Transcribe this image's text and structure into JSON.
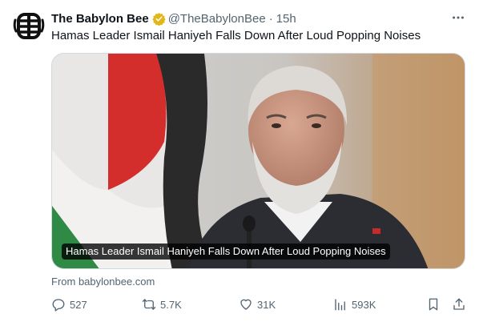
{
  "tweet": {
    "author_name": "The Babylon Bee",
    "handle": "@TheBabylonBee",
    "separator": "·",
    "time": "15h",
    "text": "Hamas Leader Ismail Haniyeh Falls Down After Loud Popping Noises"
  },
  "card": {
    "caption": "Hamas Leader Ismail Haniyeh Falls Down After Loud Popping Noises",
    "source": "From babylonbee.com"
  },
  "actions": {
    "replies": "527",
    "reposts": "5.7K",
    "likes": "31K",
    "views": "593K"
  },
  "icons": {
    "avatar": "babylon-bee-logo",
    "verified": "gold-verified-badge",
    "more": "more-horizontal-icon",
    "reply": "reply-icon",
    "repost": "repost-icon",
    "like": "heart-icon",
    "views": "views-chart-icon",
    "bookmark": "bookmark-icon",
    "share": "share-icon"
  },
  "colors": {
    "text": "#0f1419",
    "secondary": "#536471",
    "verified_gold": "#e2b719",
    "logo": "#111111"
  }
}
